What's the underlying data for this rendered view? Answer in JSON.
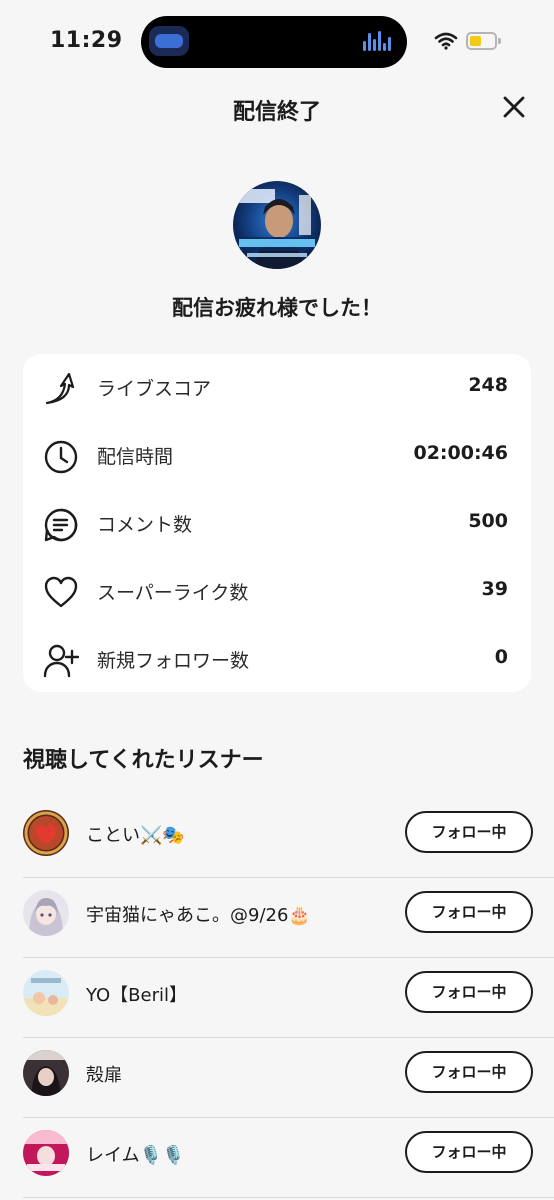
{
  "status_bar": {
    "time": "11:29"
  },
  "header": {
    "title": "配信終了",
    "close_icon": "close-icon"
  },
  "hero": {
    "headline": "配信お疲れ様でした！"
  },
  "stats": [
    {
      "icon": "arrow-score-icon",
      "label": "ライブスコア",
      "value": "248"
    },
    {
      "icon": "clock-icon",
      "label": "配信時間",
      "value": "02:00:46"
    },
    {
      "icon": "comment-icon",
      "label": "コメント数",
      "value": "500"
    },
    {
      "icon": "heart-icon",
      "label": "スーパーライク数",
      "value": "39"
    },
    {
      "icon": "add-user-icon",
      "label": "新規フォロワー数",
      "value": "0"
    }
  ],
  "listeners_section": {
    "title": "視聴してくれたリスナー",
    "follow_label": "フォロー中",
    "listeners": [
      {
        "name": "ことい⚔️🎭"
      },
      {
        "name": "宇宙猫にゃあこ。@9/26🎂"
      },
      {
        "name": "YO【Beril】"
      },
      {
        "name": "殻扉"
      },
      {
        "name": "レイム🎙️🎙️"
      }
    ]
  },
  "colors": {
    "background": "#f6f6f6",
    "card": "#ffffff",
    "text": "#1c1c1e",
    "battery": "#f5c918"
  }
}
